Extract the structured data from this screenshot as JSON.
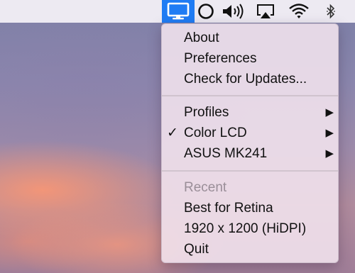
{
  "menubar": {
    "icons": [
      "display-icon",
      "circle-icon",
      "volume-icon",
      "airplay-icon",
      "wifi-icon",
      "bluetooth-icon"
    ],
    "accent_color": "#1f7cf4"
  },
  "menu": {
    "about": "About",
    "preferences": "Preferences",
    "check_updates": "Check for Updates...",
    "profiles": "Profiles",
    "color_lcd": "Color LCD",
    "color_lcd_check": "✓",
    "asus": "ASUS MK241",
    "recent_header": "Recent",
    "best_for_retina": "Best for Retina",
    "resolution": "1920 x 1200 (HiDPI)",
    "quit": "Quit"
  }
}
